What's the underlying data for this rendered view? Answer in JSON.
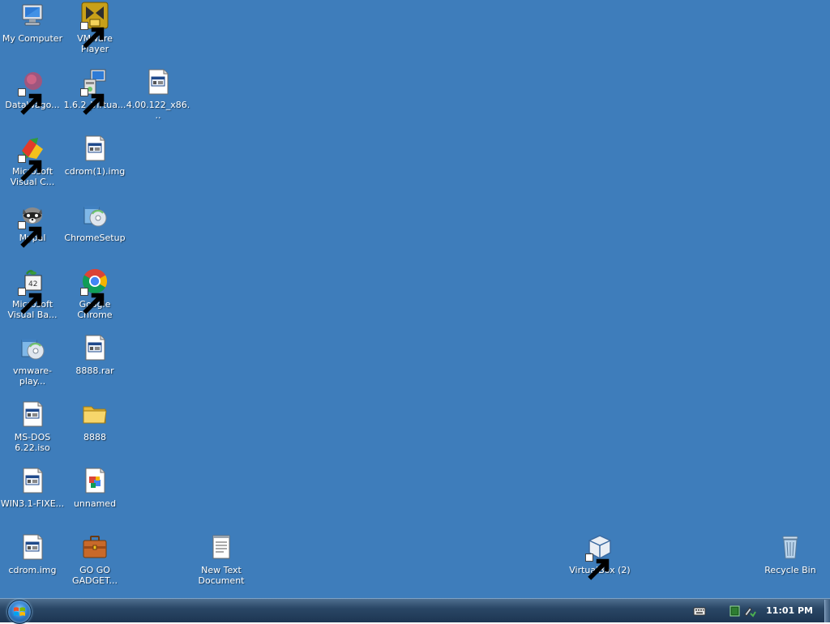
{
  "desktop": {
    "background": "#3e7dbb",
    "icons": {
      "my_computer": "My Computer",
      "vmware_player": "VMware\nPlayer",
      "datawago": "DataWago...",
      "virtua_162": "1.6.2_Virtua...",
      "x86_400": "4.00.122_x86...",
      "ms_visual_c": "Microsoft\nVisual C...",
      "cdrom1": "cdrom(1).img",
      "mypal": "Mypal",
      "chromesetup": "ChromeSetup",
      "ms_visual_ba": "Microsoft\nVisual Ba...",
      "google_chrome": "Google\nChrome",
      "vmware_play": "vmware-play...",
      "rar_8888": "8888.rar",
      "msdos": "MS-DOS\n6.22.iso",
      "folder_8888": "8888",
      "win31": "WIN3.1-FIXE...",
      "unnamed": "unnamed",
      "cdrom": "cdrom.img",
      "gogo": "GO GO\nGADGET...",
      "new_text": "New Text\nDocument",
      "virtualbox2": "VirtualBox (2)",
      "recycle_bin": "Recycle Bin"
    }
  },
  "taskbar": {
    "clock": "11:01 PM",
    "start_icon": "windows-orb-icon",
    "tray_icons": [
      "keyboard-icon",
      "network-icon",
      "safely-remove-icon"
    ]
  }
}
